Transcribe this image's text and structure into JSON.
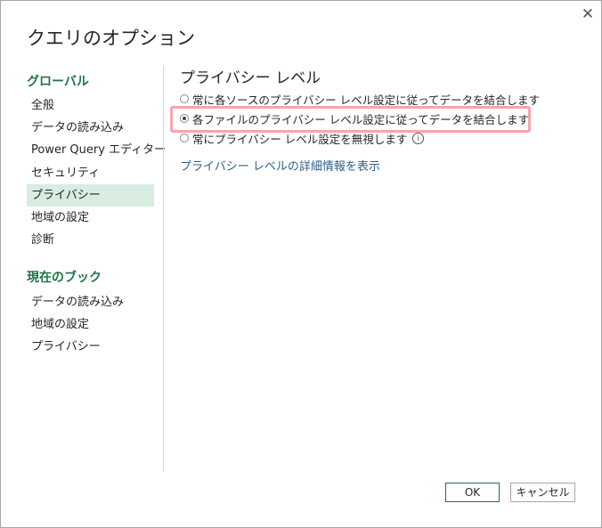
{
  "dialog": {
    "title": "クエリのオプション",
    "close_glyph": "✕"
  },
  "sidebar": {
    "global_heading": "グローバル",
    "global_items": [
      {
        "label": "全般"
      },
      {
        "label": "データの読み込み"
      },
      {
        "label": "Power Query エディター"
      },
      {
        "label": "セキュリティ"
      },
      {
        "label": "プライバシー",
        "selected": true
      },
      {
        "label": "地域の設定"
      },
      {
        "label": "診断"
      }
    ],
    "workbook_heading": "現在のブック",
    "workbook_items": [
      {
        "label": "データの読み込み"
      },
      {
        "label": "地域の設定"
      },
      {
        "label": "プライバシー"
      }
    ]
  },
  "content": {
    "title": "プライバシー レベル",
    "options": [
      {
        "label": "常に各ソースのプライバシー レベル設定に従ってデータを結合します",
        "checked": false
      },
      {
        "label": "各ファイルのプライバシー レベル設定に従ってデータを結合します",
        "checked": true
      },
      {
        "label": "常にプライバシー レベル設定を無視します",
        "checked": false
      }
    ],
    "info_glyph": "i",
    "link": "プライバシー レベルの詳細情報を表示"
  },
  "buttons": {
    "ok": "OK",
    "cancel": "キャンセル"
  },
  "colors": {
    "accent": "#217346",
    "selected_bg": "#d6ede0",
    "highlight_border": "#f4a7ac",
    "link": "#2e5f8a"
  }
}
